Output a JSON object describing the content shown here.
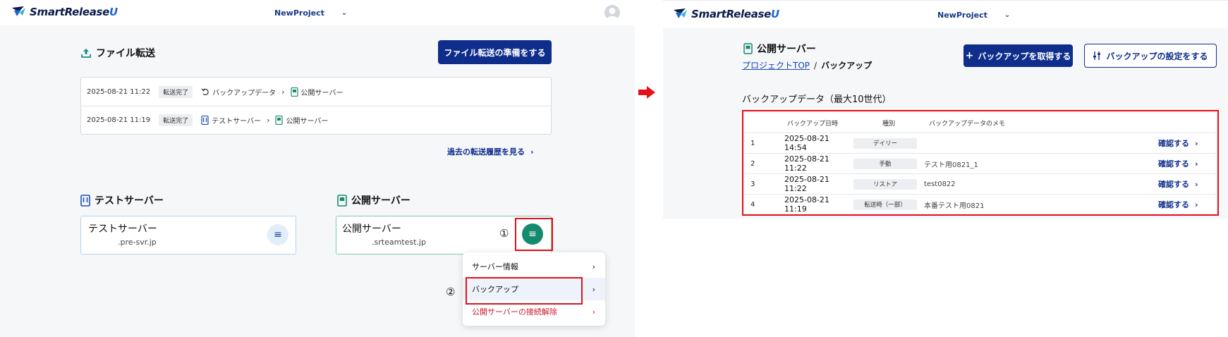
{
  "colors": {
    "primary": "#0f2e8c",
    "highlight": "#e3111b",
    "danger": "#c9192e",
    "test_server": "#1a4fb5",
    "public_server": "#168a6e"
  },
  "left": {
    "header": {
      "logo_text_main": "SmartRelease",
      "logo_text_u": "U",
      "project": "NewProject"
    },
    "file_transfer": {
      "title": "ファイル転送",
      "prepare_button": "ファイル転送の準備をする",
      "rows": [
        {
          "datetime": "2025-08-21 11:22",
          "status": "転送完了",
          "from": "バックアップデータ",
          "to": "公開サーバー"
        },
        {
          "datetime": "2025-08-21 11:19",
          "status": "転送完了",
          "from": "テストサーバー",
          "to": "公開サーバー"
        }
      ],
      "history_link": "過去の転送履歴を見る"
    },
    "test_server": {
      "section_title": "テストサーバー",
      "card_title": "テストサーバー",
      "host": ".pre-svr.jp"
    },
    "public_server": {
      "section_title": "公開サーバー",
      "card_title": "公開サーバー",
      "host": ".srteamtest.jp"
    },
    "step1": "①",
    "step2": "②",
    "menu": {
      "items": [
        {
          "label": "サーバー情報"
        },
        {
          "label": "バックアップ"
        },
        {
          "label": "公開サーバーの接続解除"
        }
      ]
    }
  },
  "right": {
    "header": {
      "logo_text_main": "SmartRelease",
      "logo_text_u": "U",
      "project": "NewProject"
    },
    "page_title": "公開サーバー",
    "breadcrumb": {
      "top": "プロジェクトTOP",
      "separator": "/",
      "current": "バックアップ"
    },
    "get_backup_button": "バックアップを取得する",
    "settings_button": "バックアップの設定をする",
    "list_title": "バックアップデータ（最大10世代）",
    "table": {
      "headers": {
        "datetime": "バックアップ日時",
        "type": "種別",
        "memo": "バックアップデータのメモ"
      },
      "rows": [
        {
          "no": "1",
          "datetime": "2025-08-21 14:54",
          "type": "デイリー",
          "memo": "",
          "action": "確認する"
        },
        {
          "no": "2",
          "datetime": "2025-08-21 11:22",
          "type": "手動",
          "memo": "テスト用0821_1",
          "action": "確認する"
        },
        {
          "no": "3",
          "datetime": "2025-08-21 11:22",
          "type": "リストア",
          "memo": "test0822",
          "action": "確認する"
        },
        {
          "no": "4",
          "datetime": "2025-08-21 11:19",
          "type": "転送時（一部）",
          "memo": "本番テスト用0821",
          "action": "確認する"
        }
      ]
    }
  }
}
